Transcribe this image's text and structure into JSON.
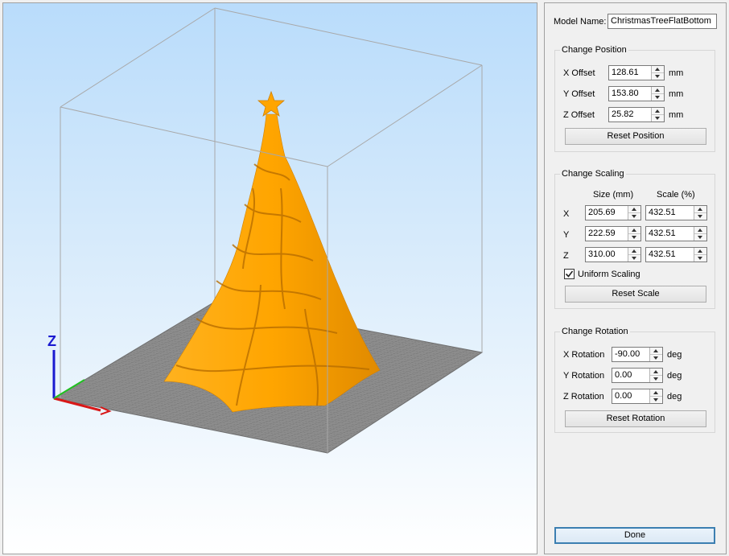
{
  "viewport": {
    "axis_z_label": "Z",
    "colors": {
      "model": "#ffa500",
      "bed": "#8c8c8c",
      "bed_grid": "#6e6e6e",
      "frame": "#a8a8a8"
    }
  },
  "panel": {
    "model_name_label": "Model Name:",
    "model_name_value": "ChristmasTreeFlatBottom",
    "position": {
      "title": "Change Position",
      "rows": [
        {
          "label": "X Offset",
          "value": "128.61",
          "unit": "mm"
        },
        {
          "label": "Y Offset",
          "value": "153.80",
          "unit": "mm"
        },
        {
          "label": "Z Offset",
          "value": "25.82",
          "unit": "mm"
        }
      ],
      "reset_label": "Reset Position"
    },
    "scaling": {
      "title": "Change Scaling",
      "size_header": "Size (mm)",
      "scale_header": "Scale (%)",
      "rows": [
        {
          "label": "X",
          "size": "205.69",
          "scale": "432.51"
        },
        {
          "label": "Y",
          "size": "222.59",
          "scale": "432.51"
        },
        {
          "label": "Z",
          "size": "310.00",
          "scale": "432.51"
        }
      ],
      "uniform_label": "Uniform Scaling",
      "uniform_checked": true,
      "reset_label": "Reset Scale"
    },
    "rotation": {
      "title": "Change Rotation",
      "rows": [
        {
          "label": "X Rotation",
          "value": "-90.00",
          "unit": "deg"
        },
        {
          "label": "Y Rotation",
          "value": "0.00",
          "unit": "deg"
        },
        {
          "label": "Z Rotation",
          "value": "0.00",
          "unit": "deg"
        }
      ],
      "reset_label": "Reset Rotation"
    },
    "done_label": "Done"
  }
}
